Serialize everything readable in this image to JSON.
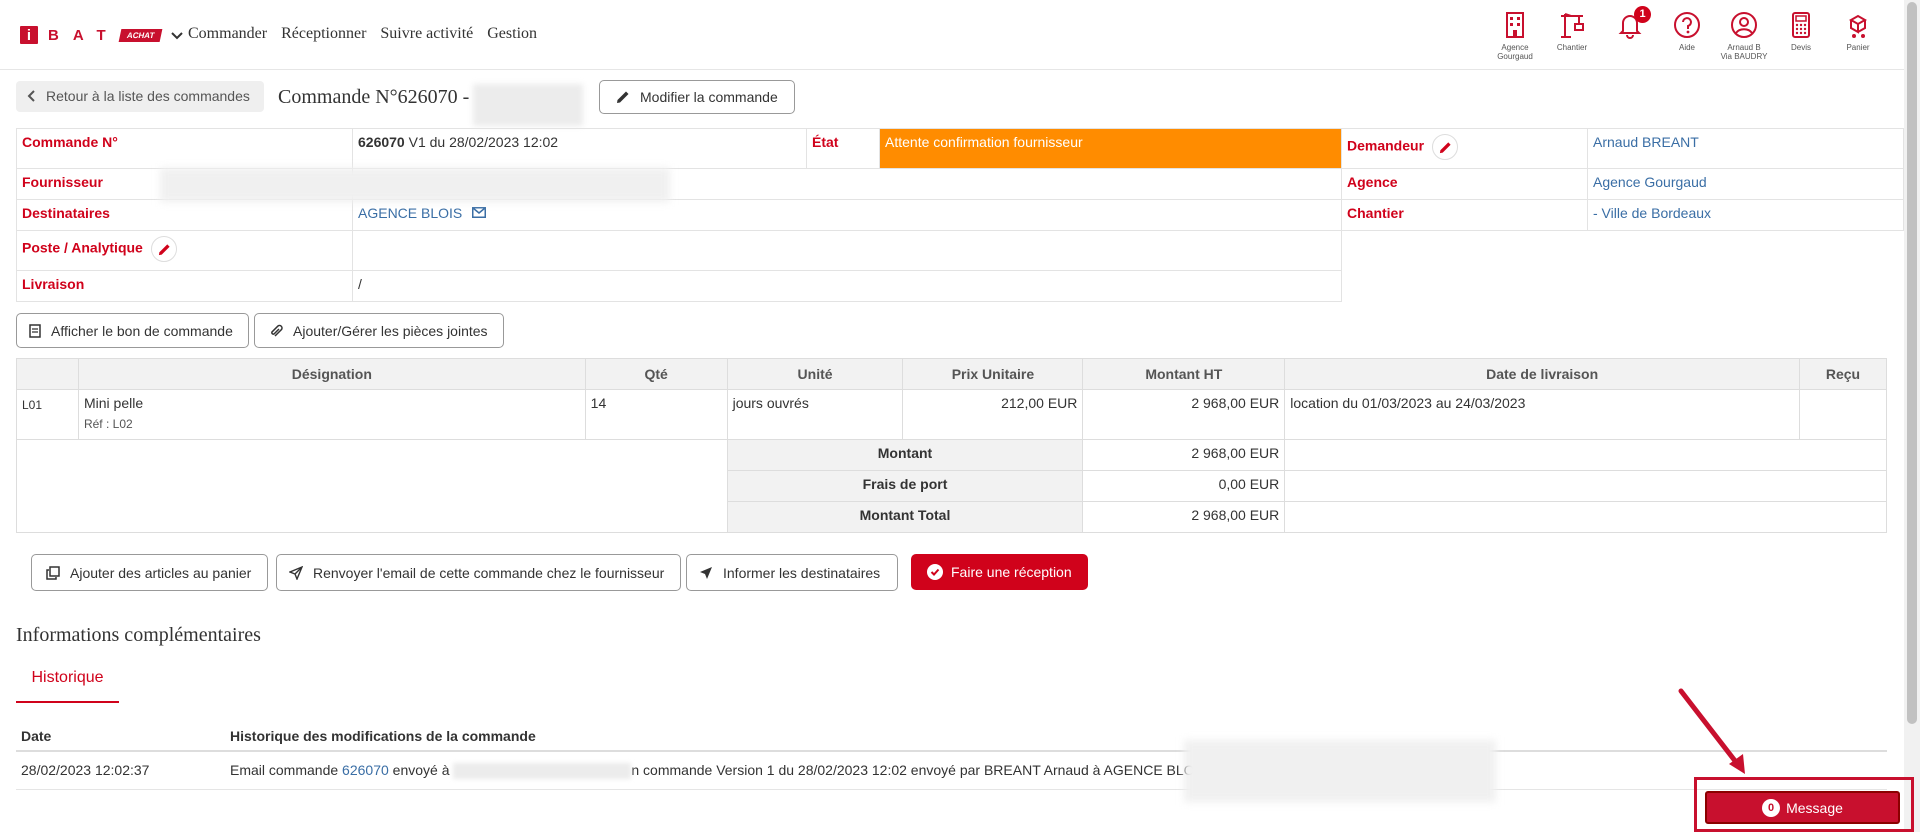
{
  "header": {
    "logo_letter": "i",
    "logo_text": "BAT",
    "logo_badge": "ACHAT",
    "nav": [
      "Commander",
      "Réceptionner",
      "Suivre activité",
      "Gestion"
    ],
    "tools": [
      {
        "label": "Agence\nGourgaud",
        "icon": "building-icon"
      },
      {
        "label": "Chantier",
        "icon": "crane-icon"
      },
      {
        "label": "",
        "icon": "bell-icon",
        "badge": "1"
      },
      {
        "label": "Aide",
        "icon": "help-icon"
      },
      {
        "label": "Arnaud B\nVia BAUDRY",
        "icon": "user-icon"
      },
      {
        "label": "Devis",
        "icon": "calculator-icon"
      },
      {
        "label": "Panier",
        "icon": "cart-icon"
      }
    ]
  },
  "title_row": {
    "back_label": "Retour à la liste des commandes",
    "title": "Commande N°626070 -",
    "edit_label": "Modifier la commande"
  },
  "info": {
    "commande_label": "Commande N°",
    "commande_num": "626070",
    "commande_rest": " V1 du 28/02/2023 12:02",
    "etat_label": "État",
    "etat_value": "Attente confirmation fournisseur",
    "demandeur_label": "Demandeur",
    "demandeur_value": "Arnaud BREANT",
    "fournisseur_label": "Fournisseur",
    "agence_label": "Agence",
    "agence_value": "Agence Gourgaud",
    "destinataires_label": "Destinataires",
    "destinataires_value": "AGENCE BLOIS",
    "chantier_label": "Chantier",
    "chantier_value": "- Ville de Bordeaux",
    "poste_label": "Poste / Analytique",
    "livraison_label": "Livraison",
    "livraison_value": "/"
  },
  "doc_buttons": {
    "bon": "Afficher le bon de commande",
    "pieces": "Ajouter/Gérer les pièces jointes"
  },
  "items": {
    "headers": [
      "",
      "Désignation",
      "Qté",
      "Unité",
      "Prix Unitaire",
      "Montant HT",
      "Date de livraison",
      "Reçu"
    ],
    "rows": [
      {
        "line": "L01",
        "designation": "Mini pelle",
        "ref": "Réf : L02",
        "qty": "14",
        "unit": "jours ouvrés",
        "unit_price": "212,00 EUR",
        "amount": "2 968,00 EUR",
        "delivery": "location du 01/03/2023 au 24/03/2023",
        "received": ""
      }
    ],
    "totals": [
      {
        "label": "Montant",
        "value": "2 968,00 EUR"
      },
      {
        "label": "Frais de port",
        "value": "0,00 EUR"
      },
      {
        "label": "Montant Total",
        "value": "2 968,00 EUR"
      }
    ]
  },
  "actions": {
    "add_cart": "Ajouter des articles au panier",
    "resend": "Renvoyer l'email de cette commande chez le fournisseur",
    "inform": "Informer les destinataires",
    "reception": "Faire une réception"
  },
  "complementary": {
    "title": "Informations complémentaires",
    "tab": "Historique",
    "headers": [
      "Date",
      "Historique des modifications de la commande"
    ],
    "rows": [
      {
        "date": "28/02/2023 12:02:37",
        "prefix": "Email commande ",
        "link": "626070",
        "middle": " envoyé à ",
        "suffix": "n commande Version 1 du 28/02/2023 12:02 envoyé par BREANT Arnaud à AGENCE BLOIS"
      }
    ]
  },
  "message": {
    "count": "0",
    "label": "Message"
  },
  "colors": {
    "brand": "#c8102e",
    "etat": "#ff8c00",
    "link": "#3a6ea5"
  }
}
